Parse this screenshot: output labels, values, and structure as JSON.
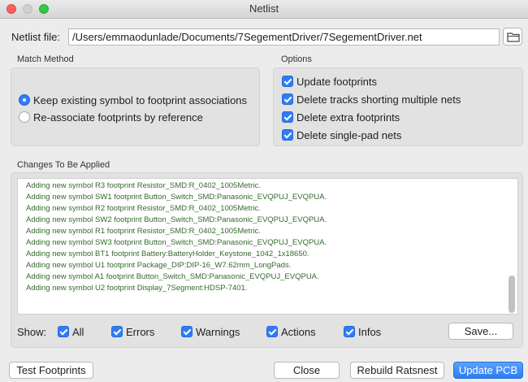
{
  "window": {
    "title": "Netlist"
  },
  "netlist_file": {
    "label": "Netlist file:",
    "value": "/Users/emmaodunlade/Documents/7SegementDriver/7SegementDriver.net",
    "browse_icon": "folder-icon"
  },
  "match_method": {
    "title": "Match Method",
    "options": [
      {
        "label": "Keep existing symbol to footprint associations",
        "selected": true
      },
      {
        "label": "Re-associate footprints by reference",
        "selected": false
      }
    ]
  },
  "options": {
    "title": "Options",
    "items": [
      {
        "label": "Update footprints",
        "checked": true
      },
      {
        "label": "Delete tracks shorting multiple nets",
        "checked": true
      },
      {
        "label": "Delete extra footprints",
        "checked": true
      },
      {
        "label": "Delete single-pad nets",
        "checked": true
      }
    ]
  },
  "changes": {
    "title": "Changes To Be Applied",
    "lines": [
      "Adding new symbol R3 footprint Resistor_SMD:R_0402_1005Metric.",
      "Adding new symbol SW1 footprint Button_Switch_SMD:Panasonic_EVQPUJ_EVQPUA.",
      "Adding new symbol R2 footprint Resistor_SMD:R_0402_1005Metric.",
      "Adding new symbol SW2 footprint Button_Switch_SMD:Panasonic_EVQPUJ_EVQPUA.",
      "Adding new symbol R1 footprint Resistor_SMD:R_0402_1005Metric.",
      "Adding new symbol SW3 footprint Button_Switch_SMD:Panasonic_EVQPUJ_EVQPUA.",
      "Adding new symbol BT1 footprint Battery:BatteryHolder_Keystone_1042_1x18650.",
      "Adding new symbol U1 footprint Package_DIP:DIP-16_W7.62mm_LongPads.",
      "Adding new symbol A1 footprint Button_Switch_SMD:Panasonic_EVQPUJ_EVQPUA.",
      "Adding new symbol U2 footprint Display_7Segment:HDSP-7401."
    ],
    "text_color": "#356a2e"
  },
  "filters": {
    "label": "Show:",
    "items": [
      {
        "label": "All",
        "checked": true
      },
      {
        "label": "Errors",
        "checked": true
      },
      {
        "label": "Warnings",
        "checked": true
      },
      {
        "label": "Actions",
        "checked": true
      },
      {
        "label": "Infos",
        "checked": true
      }
    ],
    "save_label": "Save..."
  },
  "buttons": {
    "test_footprints": "Test Footprints",
    "close": "Close",
    "rebuild_ratsnest": "Rebuild Ratsnest",
    "update_pcb": "Update PCB"
  },
  "colors": {
    "accent": "#2f7cf6"
  }
}
